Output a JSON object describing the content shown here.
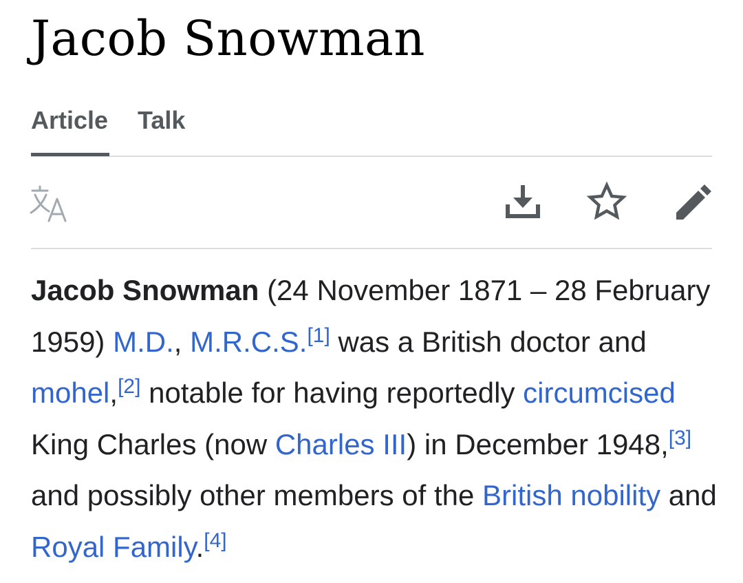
{
  "page": {
    "title": "Jacob Snowman"
  },
  "tabs": [
    {
      "label": "Article",
      "active": true
    },
    {
      "label": "Talk",
      "active": false
    }
  ],
  "toolbar": {
    "icons": [
      "language-icon",
      "download-icon",
      "star-icon",
      "edit-icon"
    ]
  },
  "article": {
    "subject": "Jacob Snowman",
    "t1": " (24 November 1871 – 28 February 1959) ",
    "link_md": "M.D.",
    "t2": ", ",
    "link_mrcs": "M.R.C.S.",
    "ref1": "[1]",
    "t3": " was a British doctor and ",
    "link_mohel": "mohel",
    "t4": ",",
    "ref2": "[2]",
    "t5": " notable for having reportedly ",
    "link_circumcised": "circumcised",
    "t6": " King Charles (now ",
    "link_charles": "Charles III",
    "t7": ") in December 1948,",
    "ref3": "[3]",
    "t8": " and possibly other members of the ",
    "link_nobility": "British nobility",
    "t9": " and ",
    "link_royal": "Royal Family",
    "t10": ".",
    "ref4": "[4]"
  },
  "colors": {
    "link": "#3366cc",
    "text": "#202122",
    "tab_text": "#54595d",
    "divider": "#dadde3",
    "icon_dark": "#54595d",
    "icon_light": "#a2a9b1"
  }
}
